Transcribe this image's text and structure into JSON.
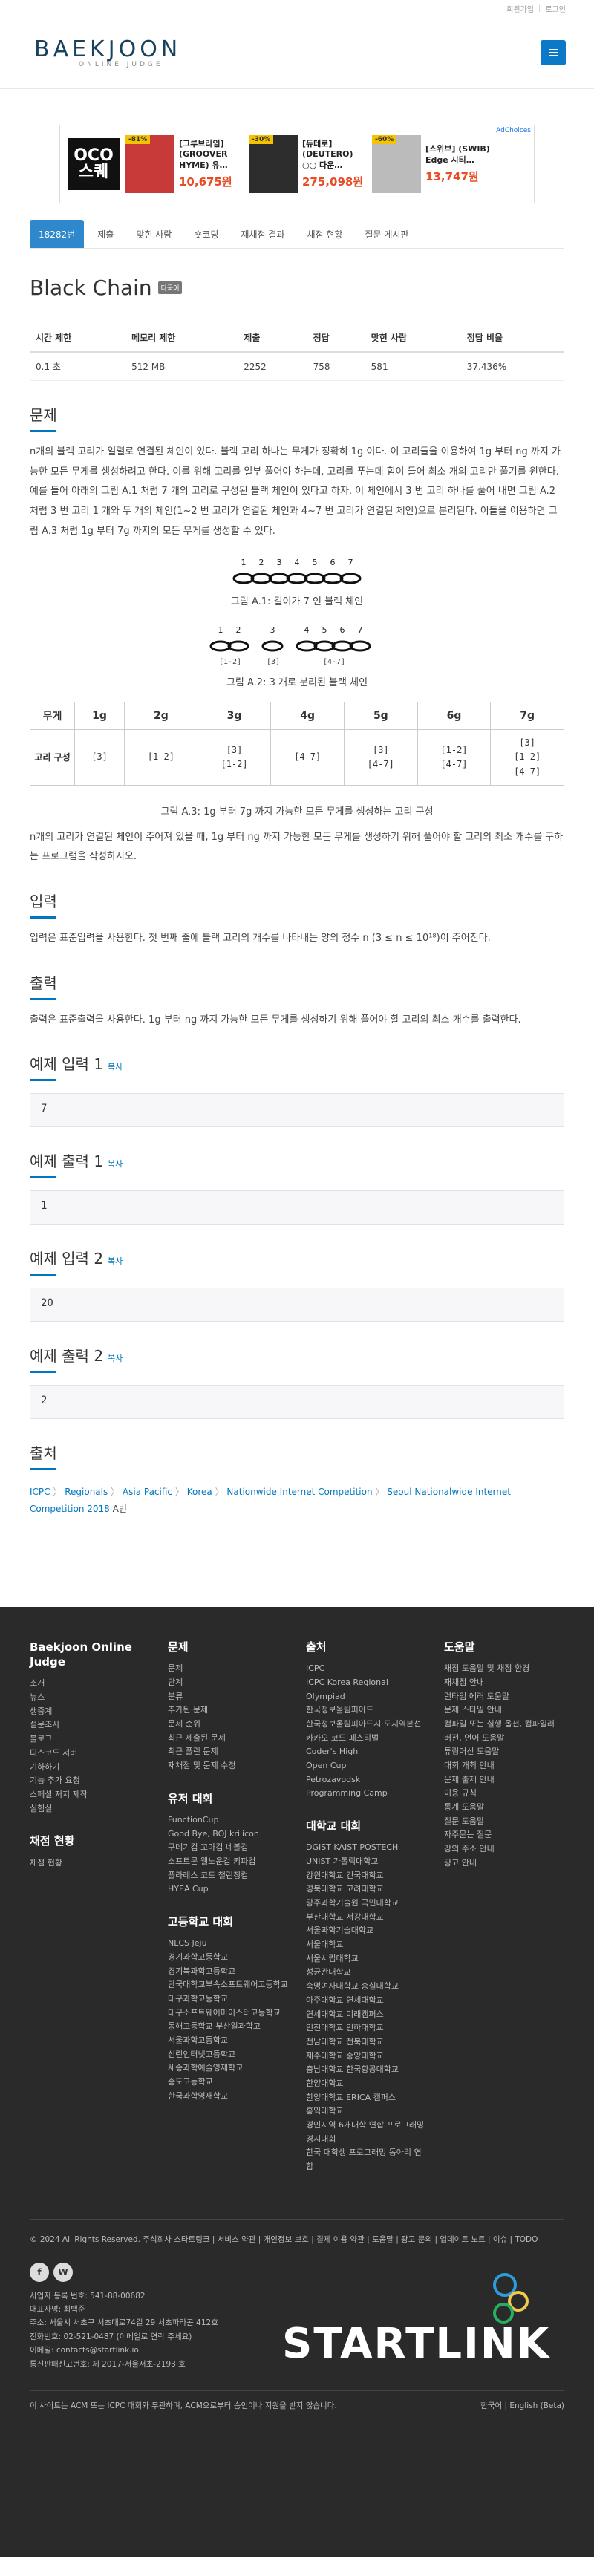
{
  "topbar": {
    "signup": "회원가입",
    "login": "로그인"
  },
  "logo": {
    "mark": "BAEKJOON",
    "sub": "ONLINE JUDGE"
  },
  "ad": {
    "flag": "AdChoices",
    "brand": "OCO 스퀘",
    "products": [
      {
        "discount": "-81%",
        "name": "[그루브라임] (GROOVER HYME) 유…",
        "price": "10,675원"
      },
      {
        "discount": "-30%",
        "name": "[듀테로] (DEUTERO) ○○ 다운…",
        "price": "275,098원"
      },
      {
        "discount": "-60%",
        "name": "[스위브] (SWIB) Edge 시티…",
        "price": "13,747원"
      }
    ]
  },
  "tabs": [
    "18282번",
    "제출",
    "맞힌 사람",
    "숏코딩",
    "재채점 결과",
    "채점 현황",
    "질문 게시판"
  ],
  "problem": {
    "title": "Black Chain",
    "badge": "다국어",
    "info_headers": [
      "시간 제한",
      "메모리 제한",
      "제출",
      "정답",
      "맞힌 사람",
      "정답 비율"
    ],
    "info_values": [
      "0.1 초",
      "512 MB",
      "2252",
      "758",
      "581",
      "37.436%"
    ]
  },
  "sections": {
    "desc_title": "문제",
    "desc_p1": "n개의 블랙 고리가 일렬로 연결된 체인이 있다. 블랙 고리 하나는 무게가 정확히 1g 이다. 이 고리들을 이용하여 1g 부터 ng 까지 가능한 모든 무게를 생성하려고 한다. 이를 위해 고리를 일부 풀어야 하는데, 고리를 푸는데 힘이 들어 최소 개의 고리만 풀기를 원한다. 예를 들어 아래의 그림 A.1 처럼 7 개의 고리로 구성된 블랙 체인이 있다고 하자. 이 체인에서 3 번 고리 하나를 풀어 내면 그림 A.2 처럼 3 번 고리 1 개와 두 개의 체인(1~2 번 고리가 연결된 체인과 4~7 번 고리가 연결된 체인)으로 분리된다. 이들을 이용하면 그림 A.3 처럼 1g 부터 7g 까지의 모든 무게를 생성할 수 있다.",
    "fig1_caption": "그림 A.1: 길이가 7 인 블랙 체인",
    "fig2_caption": "그림 A.2: 3 개로 분리된 블랙 체인",
    "fig1_numbers": [
      "1",
      "2",
      "3",
      "4",
      "5",
      "6",
      "7"
    ],
    "fig2_groups": [
      {
        "nums": [
          "1",
          "2"
        ],
        "label": "[1-2]"
      },
      {
        "nums": [
          "3"
        ],
        "label": "[3]"
      },
      {
        "nums": [
          "4",
          "5",
          "6",
          "7"
        ],
        "label": "[4-7]"
      }
    ],
    "weights_header": [
      "무게",
      "1g",
      "2g",
      "3g",
      "4g",
      "5g",
      "6g",
      "7g"
    ],
    "weights_rowhead": "고리 구성",
    "weights_cells": [
      "[3]",
      "[1-2]",
      "[3]\n[1-2]",
      "[4-7]",
      "[3]\n[4-7]",
      "[1-2]\n[4-7]",
      "[3]\n[1-2]\n[4-7]"
    ],
    "fig3_caption": "그림 A.3: 1g 부터 7g 까지 가능한 모든 무게를 생성하는 고리 구성",
    "desc_p2": "n개의 고리가 연결된 체인이 주어져 있을 때, 1g 부터 ng 까지 가능한 모든 무게를 생성하기 위해 풀어야 할 고리의 최소 개수를 구하는 프로그램을 작성하시오.",
    "input_title": "입력",
    "input_p": "입력은 표준입력을 사용한다. 첫 번째 줄에 블랙 고리의 개수를 나타내는 양의 정수 n (3 ≤ n ≤ 10¹⁸)이 주어진다.",
    "output_title": "출력",
    "output_p": "출력은 표준출력을 사용한다. 1g 부터 ng 까지 가능한 모든 무게를 생성하기 위해 풀어야 할 고리의 최소 개수를 출력한다.",
    "copy": "복사",
    "sample_in1_title": "예제 입력 1",
    "sample_in1": "7",
    "sample_out1_title": "예제 출력 1",
    "sample_out1": "1",
    "sample_in2_title": "예제 입력 2",
    "sample_in2": "20",
    "sample_out2_title": "예제 출력 2",
    "sample_out2": "2",
    "source_title": "출처",
    "source_path": [
      "ICPC",
      "Regionals",
      "Asia Pacific",
      "Korea",
      "Nationwide Internet Competition",
      "Seoul Nationalwide Internet Competition 2018"
    ],
    "source_suffix": "A번"
  },
  "footer": {
    "col1_title": "Baekjoon Online Judge",
    "col1": [
      "소개",
      "뉴스",
      "생중계",
      "설문조사",
      "블로그",
      "디스코드 서버",
      "기하하기",
      "기능 추가 요청",
      "스페셜 저지 제작",
      "실험실"
    ],
    "col1b_title": "채점 현황",
    "col1b": [
      "채점 현황"
    ],
    "col2_title": "문제",
    "col2": [
      "문제",
      "단계",
      "분류",
      "추가된 문제",
      "문제 순위",
      "최근 제출된 문제",
      "최근 풀린 문제",
      "재채점 및 문제 수정"
    ],
    "col2b_title": "유저 대회",
    "col2b": [
      "FunctionCup",
      "Good Bye, BOJ kriiicon",
      "구데기컵 꼬마컵 네볼컵",
      "소프트콘 웰노운컵 키파컵",
      "플라레스 코드 챌린징컵",
      "HYEA Cup"
    ],
    "col2c_title": "고등학교 대회",
    "col2c": [
      "NLCS Jeju",
      "경기과학고등학교",
      "경기북과학고등학교",
      "단국대학교부속소프트웨어고등학교",
      "대구과학고등학교",
      "대구소프트웨어마이스터고등학교",
      "동해고등학교 부산일과학고",
      "서울과학고등학교",
      "선린인터넷고등학교",
      "세종과학예술영재학교",
      "송도고등학교",
      "한국과학영재학교"
    ],
    "col3_title": "출처",
    "col3": [
      "ICPC",
      "ICPC Korea Regional",
      "Olympiad",
      "한국정보올림피아드",
      "한국정보올림피아드시·도지역본선",
      "카카오 코드 페스티벌",
      "Coder's High",
      "Open Cup",
      "Petrozavodsk",
      "Programming Camp"
    ],
    "col3b_title": "대학교 대회",
    "col3b": [
      "DGIST KAIST POSTECH",
      "UNIST 가톨릭대학교",
      "강원대학교 건국대학교",
      "경북대학교 고려대학교",
      "광주과학기술원 국민대학교",
      "부산대학교 서강대학교",
      "서울과학기술대학교",
      "서울대학교",
      "서울시립대학교",
      "성균관대학교",
      "숙명여자대학교 숭실대학교",
      "아주대학교 연세대학교",
      "연세대학교 미래캠퍼스",
      "인천대학교 인하대학교",
      "전남대학교 전북대학교",
      "제주대학교 중앙대학교",
      "충남대학교 한국항공대학교",
      "한양대학교",
      "한양대학교 ERICA 캠퍼스",
      "홍익대학교",
      "경인지역 6개대학 연합 프로그래밍 경시대회",
      "한국 대학생 프로그래밍 동아리 연합"
    ],
    "col4_title": "도움말",
    "col4": [
      "채점 도움말 및 채점 환경",
      "재채점 안내",
      "런타임 에러 도움말",
      "문제 스타일 안내",
      "컴파일 또는 실행 옵션, 컴파일러 버전, 언어 도움말",
      "튜링머신 도움말",
      "대회 개최 안내",
      "문제 출제 안내",
      "이용 규칙",
      "통계 도움말",
      "질문 도움말",
      "자주묻는 질문",
      "강의 주소 안내",
      "광고 안내"
    ],
    "copyright": "© 2024 All Rights Reserved. 주식회사 스타트링크  |  서비스 약관  |  개인정보 보호  |  결제 이용 약관  |  도움말  |  광고 문의  |  업데이트 노트  |  이슈  |  TODO",
    "social": [
      "f",
      "W"
    ],
    "biz": [
      "사업자 등록 번호: 541-88-00682",
      "대표자명: 최백준",
      "주소: 서울시 서초구 서초대로74길 29 서초파라곤 412호",
      "전화번호: 02-521-0487 (이메일로 연락 주세요)",
      "이메일: contacts@startlink.io",
      "통신판매신고번호: 제 2017-서울서초-2193 호"
    ],
    "startlink": "STARTLINK",
    "bottom_left": "이 사이트는 ACM 또는 ICPC 대회와 무관하며, ACM으로부터 승인이나 지원을 받지 않습니다.",
    "bottom_right": "한국어 | English (Beta)"
  }
}
